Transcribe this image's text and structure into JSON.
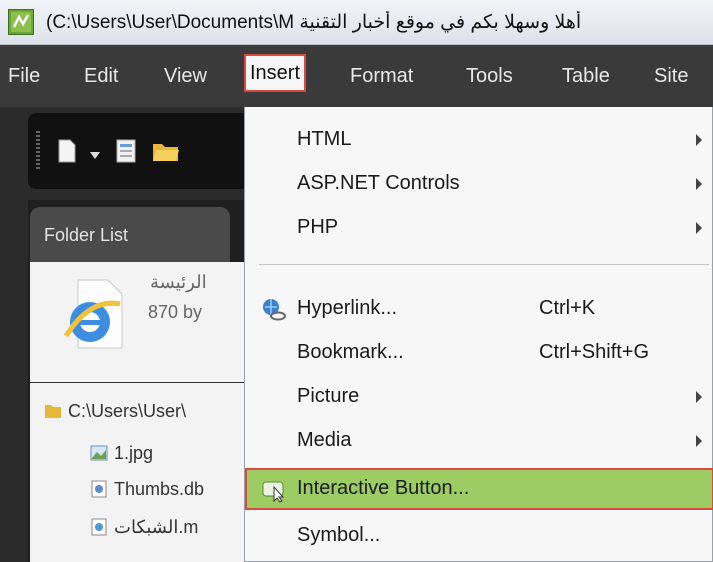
{
  "window": {
    "title": "(C:\\Users\\User\\Documents\\M أهلا وسهلا بكم في موقع أخبار التقنية",
    "app_icon": "expression-web-icon"
  },
  "menubar": {
    "items": [
      "File",
      "Edit",
      "View",
      "Insert",
      "Format",
      "Tools",
      "Table",
      "Site"
    ],
    "active": "Insert",
    "active_outline_color": "#d94a3e"
  },
  "toolbar": {
    "icons": [
      "new-page-icon",
      "dropdown-arrow-icon",
      "page-icon",
      "open-folder-icon"
    ]
  },
  "folder_panel": {
    "tab_label": "Folder List",
    "preview": {
      "name": "الرئيسة",
      "size": "870 by",
      "icon": "internet-explorer-icon"
    },
    "tree": [
      {
        "label": "C:\\Users\\User\\",
        "icon": "folder-icon"
      },
      {
        "label": "1.jpg",
        "icon": "image-file-icon"
      },
      {
        "label": "Thumbs.db",
        "icon": "db-file-icon"
      },
      {
        "label": "الشبكات.m",
        "icon": "web-file-icon"
      }
    ]
  },
  "insert_menu": {
    "items": [
      {
        "label": "HTML",
        "submenu": true
      },
      {
        "label": "ASP.NET Controls",
        "submenu": true
      },
      {
        "label": "PHP",
        "submenu": true
      },
      {
        "label": "Hyperlink...",
        "shortcut": "Ctrl+K",
        "icon": "hyperlink-icon"
      },
      {
        "label": "Bookmark...",
        "shortcut": "Ctrl+Shift+G"
      },
      {
        "label": "Picture",
        "submenu": true
      },
      {
        "label": "Media",
        "submenu": true
      },
      {
        "label": "Interactive Button...",
        "icon": "interactive-button-icon",
        "highlighted": true
      },
      {
        "label": "Symbol..."
      }
    ],
    "highlight_color": "#9ccc63"
  }
}
